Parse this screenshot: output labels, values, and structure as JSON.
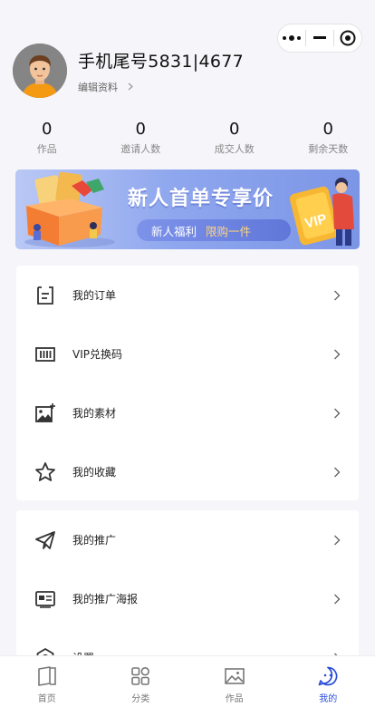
{
  "header": {
    "user_name": "手机尾号5831|4677",
    "edit_profile": "编辑资料"
  },
  "stats": [
    {
      "value": "0",
      "label": "作品"
    },
    {
      "value": "0",
      "label": "邀请人数"
    },
    {
      "value": "0",
      "label": "成交人数"
    },
    {
      "value": "0",
      "label": "剩余天数"
    }
  ],
  "banner": {
    "title": "新人首单专享价",
    "pill_left": "新人福利",
    "pill_right": "限购一件",
    "badge": "VIP"
  },
  "menu_group_1": [
    {
      "label": "我的订单",
      "icon": "order-icon"
    },
    {
      "label": "VIP兑换码",
      "icon": "barcode-icon"
    },
    {
      "label": "我的素材",
      "icon": "image-add-icon"
    },
    {
      "label": "我的收藏",
      "icon": "star-icon"
    }
  ],
  "menu_group_2": [
    {
      "label": "我的推广",
      "icon": "paper-plane-icon"
    },
    {
      "label": "我的推广海报",
      "icon": "poster-icon"
    },
    {
      "label": "设置",
      "icon": "settings-icon"
    }
  ],
  "tabbar": [
    {
      "label": "首页",
      "icon": "home-book-icon"
    },
    {
      "label": "分类",
      "icon": "grid-icon"
    },
    {
      "label": "作品",
      "icon": "picture-icon"
    },
    {
      "label": "我的",
      "icon": "chat-face-icon"
    }
  ],
  "colors": {
    "accent": "#2c4ed8",
    "banner": "#8fa7ee",
    "background": "#f6f6fa"
  }
}
